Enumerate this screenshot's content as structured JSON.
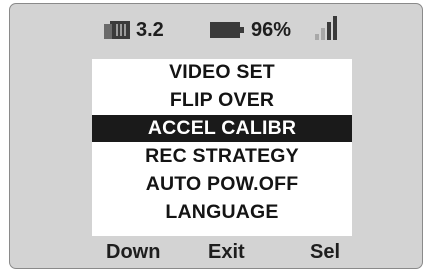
{
  "status_bar": {
    "memory_icon": "memory-card-icon",
    "memory_value": "3.2",
    "battery_icon": "battery-icon",
    "battery_value": "96%",
    "signal_icon": "signal-strength-icon",
    "signal_bars_total": 4,
    "signal_bars_active": 2
  },
  "menu": {
    "items": [
      {
        "label": "VIDEO SET",
        "selected": false
      },
      {
        "label": "FLIP OVER",
        "selected": false
      },
      {
        "label": "ACCEL CALIBR",
        "selected": true
      },
      {
        "label": "REC STRATEGY",
        "selected": false
      },
      {
        "label": "AUTO POW.OFF",
        "selected": false
      },
      {
        "label": "LANGUAGE",
        "selected": false
      }
    ]
  },
  "softkeys": {
    "left": "Down",
    "center": "Exit",
    "right": "Sel"
  },
  "colors": {
    "screen_background": "#d3d3d3",
    "menu_background": "#ffffff",
    "highlight_background": "#1a1a1a",
    "highlight_text": "#ffffff",
    "text": "#1e1e1e",
    "signal_active": "#3a3a3a",
    "signal_inactive": "#a8a8a8"
  }
}
